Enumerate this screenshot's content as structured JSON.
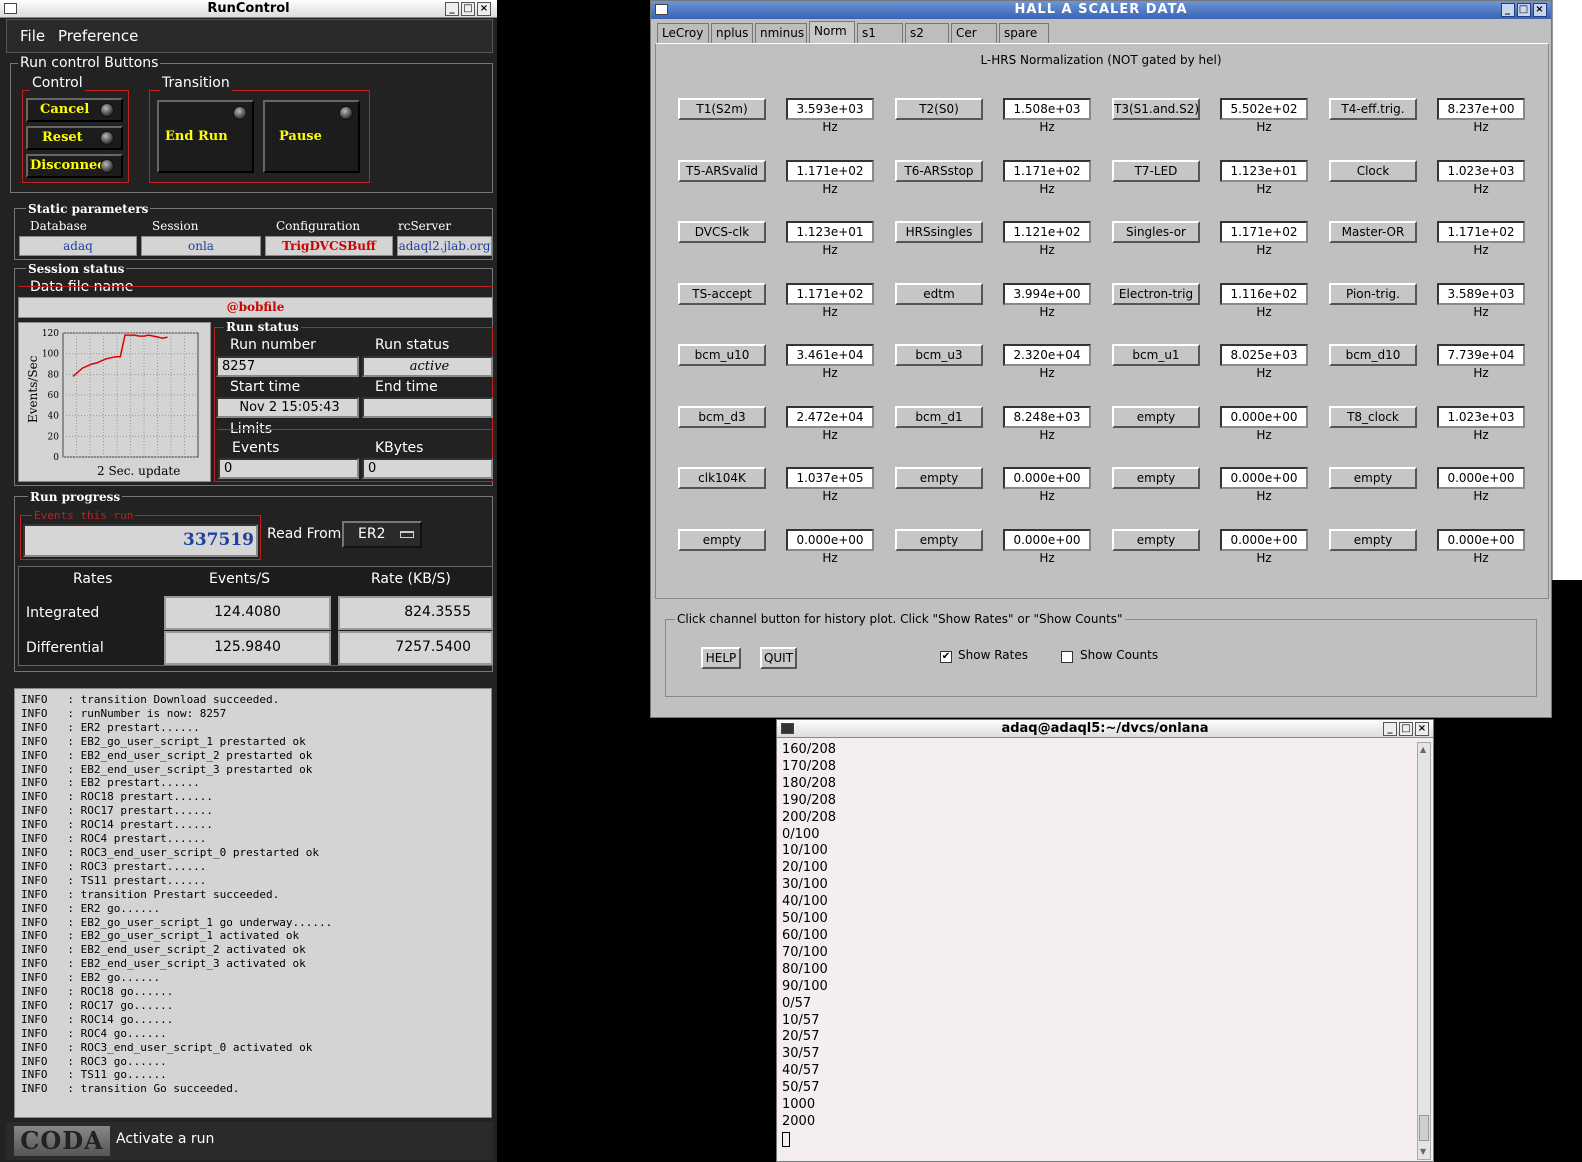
{
  "runcontrol": {
    "title": "RunControl",
    "menu": {
      "file": "File",
      "preference": "Preference"
    },
    "run_control_buttons_label": "Run control Buttons",
    "control_label": "Control",
    "transition_label": "Transition",
    "buttons": {
      "cancel": "Cancel",
      "reset": "Reset",
      "disconnect": "Disconnect",
      "end_run": "End Run",
      "pause": "Pause"
    },
    "static_params_label": "Static parameters",
    "static": {
      "database_label": "Database",
      "database": "adaq",
      "session_label": "Session",
      "session": "onla",
      "configuration_label": "Configuration",
      "configuration": "TrigDVCSBuff",
      "rcserver_label": "rcServer",
      "rcserver": "adaql2.jlab.org"
    },
    "session_status_label": "Session status",
    "data_file_label": "Data file name",
    "data_file": "@bobfile",
    "chart_update_label": "2 Sec. update",
    "run_status_label": "Run status",
    "run_number_label": "Run number",
    "run_number": "8257",
    "run_status_field_label": "Run status",
    "run_status": "active",
    "start_time_label": "Start time",
    "start_time": "Nov 2 15:05:43",
    "end_time_label": "End time",
    "end_time": "",
    "limits_label": "Limits",
    "events_label": "Events",
    "events_limit": "0",
    "kbytes_label": "KBytes",
    "kbytes_limit": "0",
    "run_progress_label": "Run progress",
    "events_this_run_label": "Events this run",
    "events_this_run": "337519",
    "read_from_label": "Read From:",
    "read_from": "ER2",
    "rates": {
      "col_rates": "Rates",
      "col_events": "Events/S",
      "col_rate": "Rate (KB/S)",
      "integrated_label": "Integrated",
      "integrated_events": "124.4080",
      "integrated_rate": "824.3555",
      "differential_label": "Differential",
      "differential_events": "125.9840",
      "differential_rate": "7257.5400"
    },
    "log": [
      "INFO   : transition Download succeeded.",
      "INFO   : runNumber is now: 8257",
      "INFO   : ER2 prestart......",
      "INFO   : EB2_go_user_script_1 prestarted ok",
      "INFO   : EB2_end_user_script_2 prestarted ok",
      "INFO   : EB2_end_user_script_3 prestarted ok",
      "INFO   : EB2 prestart......",
      "INFO   : ROC18 prestart......",
      "INFO   : ROC17 prestart......",
      "INFO   : ROC14 prestart......",
      "INFO   : ROC4 prestart......",
      "INFO   : ROC3_end_user_script_0 prestarted ok",
      "INFO   : ROC3 prestart......",
      "INFO   : TS11 prestart......",
      "INFO   : transition Prestart succeeded.",
      "INFO   : ER2 go......",
      "INFO   : EB2_go_user_script_1 go underway......",
      "INFO   : EB2_go_user_script_1 activated ok",
      "INFO   : EB2_end_user_script_2 activated ok",
      "INFO   : EB2_end_user_script_3 activated ok",
      "INFO   : EB2 go......",
      "INFO   : ROC18 go......",
      "INFO   : ROC17 go......",
      "INFO   : ROC14 go......",
      "INFO   : ROC4 go......",
      "INFO   : ROC3_end_user_script_0 activated ok",
      "INFO   : ROC3 go......",
      "INFO   : TS11 go......",
      "INFO   : transition Go succeeded."
    ],
    "status_logo": "CODA",
    "status_text": "Activate a run"
  },
  "chart_data": {
    "type": "line",
    "ylabel": "Events/Sec",
    "xlabel": "2 Sec. update",
    "ylim": [
      0,
      120
    ],
    "yticks": [
      "0",
      "20",
      "40",
      "60",
      "80",
      "100",
      "120"
    ],
    "series": [
      {
        "values": [
          78,
          82,
          86,
          88,
          90,
          91,
          93,
          95,
          96,
          97,
          97,
          118,
          118,
          118,
          117,
          117,
          118,
          117,
          116,
          115,
          116
        ]
      }
    ],
    "line_color": "#e00000"
  },
  "scaler": {
    "title": "HALL  A  SCALER  DATA",
    "tabs": [
      "LeCroy",
      "nplus",
      "nminus",
      "Norm",
      "s1",
      "s2",
      "Cer",
      "spare"
    ],
    "active_tab": "Norm",
    "heading": "L-HRS Normalization (NOT gated by hel)",
    "rows": [
      [
        [
          "T1(S2m)",
          "3.593e+03 Hz"
        ],
        [
          "T2(S0)",
          "1.508e+03 Hz"
        ],
        [
          "T3(S1.and.S2)",
          "5.502e+02 Hz"
        ],
        [
          "T4-eff.trig.",
          "8.237e+00 Hz"
        ]
      ],
      [
        [
          "T5-ARSvalid",
          "1.171e+02 Hz"
        ],
        [
          "T6-ARSstop",
          "1.171e+02 Hz"
        ],
        [
          "T7-LED",
          "1.123e+01 Hz"
        ],
        [
          "Clock",
          "1.023e+03 Hz"
        ]
      ],
      [
        [
          "DVCS-clk",
          "1.123e+01 Hz"
        ],
        [
          "HRSsingles",
          "1.121e+02 Hz"
        ],
        [
          "Singles-or",
          "1.171e+02 Hz"
        ],
        [
          "Master-OR",
          "1.171e+02 Hz"
        ]
      ],
      [
        [
          "TS-accept",
          "1.171e+02 Hz"
        ],
        [
          "edtm",
          "3.994e+00 Hz"
        ],
        [
          "Electron-trig",
          "1.116e+02 Hz"
        ],
        [
          "Pion-trig.",
          "3.589e+03 Hz"
        ]
      ],
      [
        [
          "bcm_u10",
          "3.461e+04 Hz"
        ],
        [
          "bcm_u3",
          "2.320e+04 Hz"
        ],
        [
          "bcm_u1",
          "8.025e+03 Hz"
        ],
        [
          "bcm_d10",
          "7.739e+04 Hz"
        ]
      ],
      [
        [
          "bcm_d3",
          "2.472e+04 Hz"
        ],
        [
          "bcm_d1",
          "8.248e+03 Hz"
        ],
        [
          "empty",
          "0.000e+00 Hz"
        ],
        [
          "T8_clock",
          "1.023e+03 Hz"
        ]
      ],
      [
        [
          "clk104K",
          "1.037e+05 Hz"
        ],
        [
          "empty",
          "0.000e+00 Hz"
        ],
        [
          "empty",
          "0.000e+00 Hz"
        ],
        [
          "empty",
          "0.000e+00 Hz"
        ]
      ],
      [
        [
          "empty",
          "0.000e+00 Hz"
        ],
        [
          "empty",
          "0.000e+00 Hz"
        ],
        [
          "empty",
          "0.000e+00 Hz"
        ],
        [
          "empty",
          "0.000e+00 Hz"
        ]
      ]
    ],
    "instruction": "Click channel button for history plot.  Click \"Show Rates\" or \"Show Counts\"",
    "help_label": "HELP",
    "quit_label": "QUIT",
    "show_rates_label": "Show Rates",
    "show_rates_checked": true,
    "show_counts_label": "Show Counts",
    "show_counts_checked": false
  },
  "terminal": {
    "title": "adaq@adaql5:~/dvcs/onlana",
    "lines": [
      "160/208",
      "170/208",
      "180/208",
      "190/208",
      "200/208",
      "0/100",
      "10/100",
      "20/100",
      "30/100",
      "40/100",
      "50/100",
      "60/100",
      "70/100",
      "80/100",
      "90/100",
      "0/57",
      "10/57",
      "20/57",
      "30/57",
      "40/57",
      "50/57",
      "1000",
      "2000"
    ]
  }
}
